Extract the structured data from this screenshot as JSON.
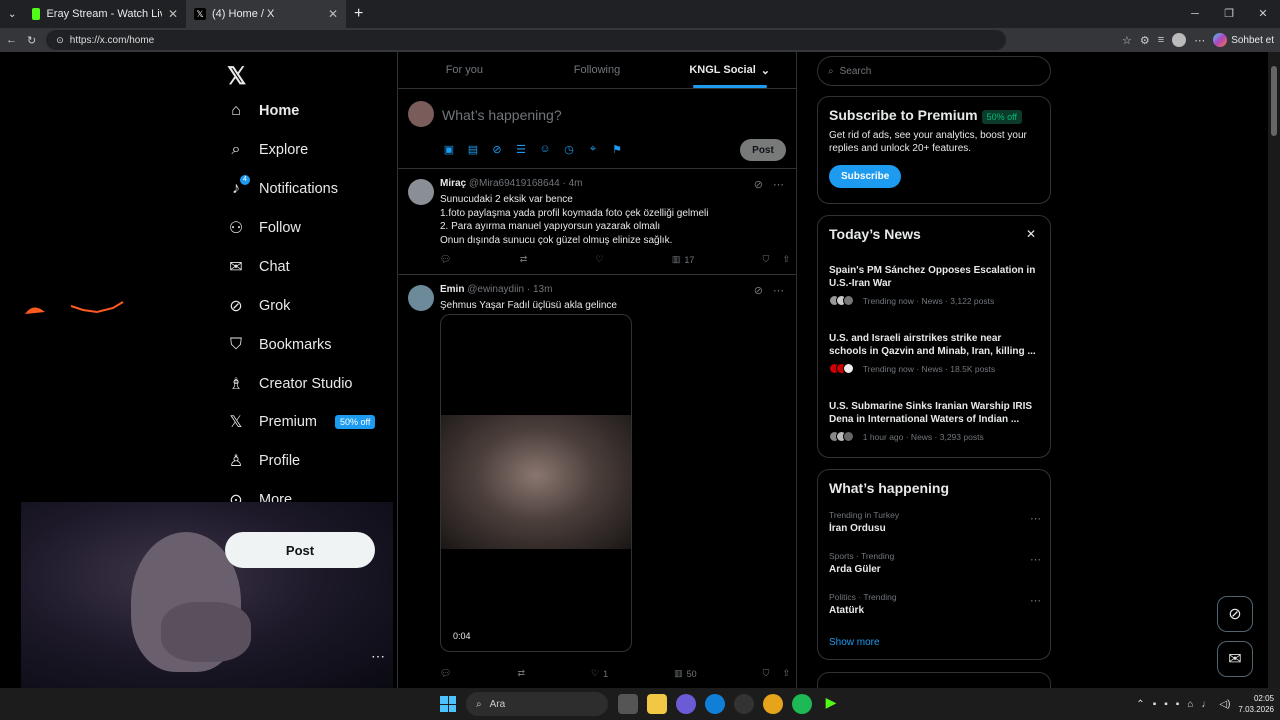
{
  "browser": {
    "tabs": [
      {
        "title": "Eray Stream - Watch Live on Kick",
        "fav_color": "#53fc18"
      },
      {
        "title": "(4) Home / X",
        "fav_color": "#000000"
      }
    ],
    "url": "https://x.com/home",
    "copilot_label": "Sohbet et"
  },
  "nav": {
    "items": [
      {
        "label": "Home"
      },
      {
        "label": "Explore"
      },
      {
        "label": "Notifications"
      },
      {
        "label": "Follow"
      },
      {
        "label": "Chat"
      },
      {
        "label": "Grok"
      },
      {
        "label": "Bookmarks"
      },
      {
        "label": "Creator Studio"
      },
      {
        "label": "Premium"
      },
      {
        "label": "Profile"
      },
      {
        "label": "More"
      }
    ],
    "notifications_badge": "4",
    "premium_badge": "50% off",
    "post_label": "Post"
  },
  "feed": {
    "tabs": [
      "For you",
      "Following",
      "KNGL Social"
    ],
    "compose_placeholder": "What’s happening?",
    "compose_post_label": "Post",
    "tweets": [
      {
        "name": "Miraç",
        "handle": "@Mira69419168644",
        "time": "· 4m",
        "lines": [
          "Sunucudaki 2 eksik var bence",
          "1.foto paylaşma yada profil koymada foto çek özelliği gelmeli",
          "2. Para ayırma manuel yapıyorsun yazarak olmalı",
          "Onun dışında sunucu çok güzel olmuş elinize sağlık."
        ],
        "views": "17"
      },
      {
        "name": "Emin",
        "handle": "@ewinaydiin",
        "time": "· 13m",
        "lines": [
          "Şehmus Yaşar Fadıl üçlüsü akla gelince"
        ],
        "video_time": "0:04",
        "likes": "1",
        "views": "50"
      }
    ]
  },
  "right": {
    "search_placeholder": "Search",
    "premium": {
      "title": "Subscribe to Premium",
      "badge": "50% off",
      "desc": "Get rid of ads, see your analytics, boost your replies and unlock 20+ features.",
      "button": "Subscribe"
    },
    "news": {
      "title": "Today’s News",
      "items": [
        {
          "headline": "Spain's PM Sánchez Opposes Escalation in U.S.-Iran War",
          "meta": "Trending now · News · 3,122 posts"
        },
        {
          "headline": "U.S. and Israeli airstrikes strike near schools in Qazvin and Minab, Iran, killing ...",
          "meta": "Trending now · News · 18.5K posts"
        },
        {
          "headline": "U.S. Submarine Sinks Iranian Warship IRIS Dena in International Waters of Indian ...",
          "meta": "1 hour ago · News · 3,293 posts"
        }
      ]
    },
    "happening": {
      "title": "What’s happening",
      "items": [
        {
          "category": "Trending in Turkey",
          "name": "İran Ordusu"
        },
        {
          "category": "Sports · Trending",
          "name": "Arda Güler"
        },
        {
          "category": "Politics · Trending",
          "name": "Atatürk"
        }
      ],
      "show_more": "Show more"
    }
  },
  "taskbar": {
    "search_label": "Ara",
    "time": "02:05",
    "date": "7.03.2026"
  },
  "colors": {
    "accent": "#1d9bf0",
    "background": "#000000",
    "border": "#2f3336"
  }
}
